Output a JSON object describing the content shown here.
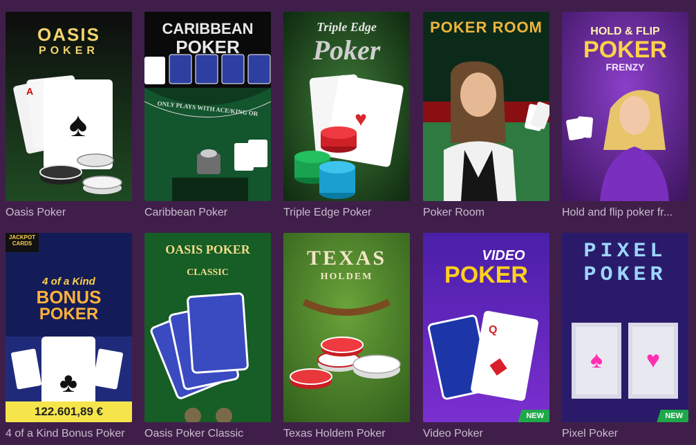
{
  "games": [
    {
      "title": "Oasis Poker",
      "logo_line1": "OASIS",
      "logo_line2": "POKER"
    },
    {
      "title": "Caribbean Poker",
      "logo_line1": "CARIBBEAN",
      "logo_line2": "POKER",
      "table_text": "ONLY PLAYS WITH ACE/KING OR"
    },
    {
      "title": "Triple Edge Poker",
      "logo_line1": "Triple Edge",
      "logo_line2": "Poker"
    },
    {
      "title": "Poker Room",
      "logo_line1": "POKER ROOM"
    },
    {
      "title": "Hold and flip poker fr...",
      "logo_line1": "HOLD & FLIP",
      "logo_line2": "POKER",
      "logo_line3": "FRENZY"
    },
    {
      "title": "4 of a Kind Bonus Poker",
      "logo_line1": "4 of a Kind",
      "logo_line2": "BONUS",
      "logo_line3": "POKER",
      "corner_label": "JACKPOT CARDS",
      "jackpot": "122.601,89 €"
    },
    {
      "title": "Oasis Poker Classic",
      "logo_line1": "OASIS POKER",
      "logo_line2": "CLASSIC"
    },
    {
      "title": "Texas Holdem Poker",
      "logo_line1": "TEXAS",
      "logo_line2": "HOLDEM"
    },
    {
      "title": "Video Poker",
      "logo_line1": "VIDEO",
      "logo_line2": "POKER",
      "badge": "NEW"
    },
    {
      "title": "Pixel Poker",
      "logo_line1": "PIXEL",
      "logo_line2": "POKER",
      "badge": "NEW"
    }
  ],
  "colors": {
    "page_bg": "#3f1f4a",
    "title_text": "#c9bccd",
    "new_badge": "#1fa84a",
    "jackpot_bg": "#f5e54b"
  }
}
